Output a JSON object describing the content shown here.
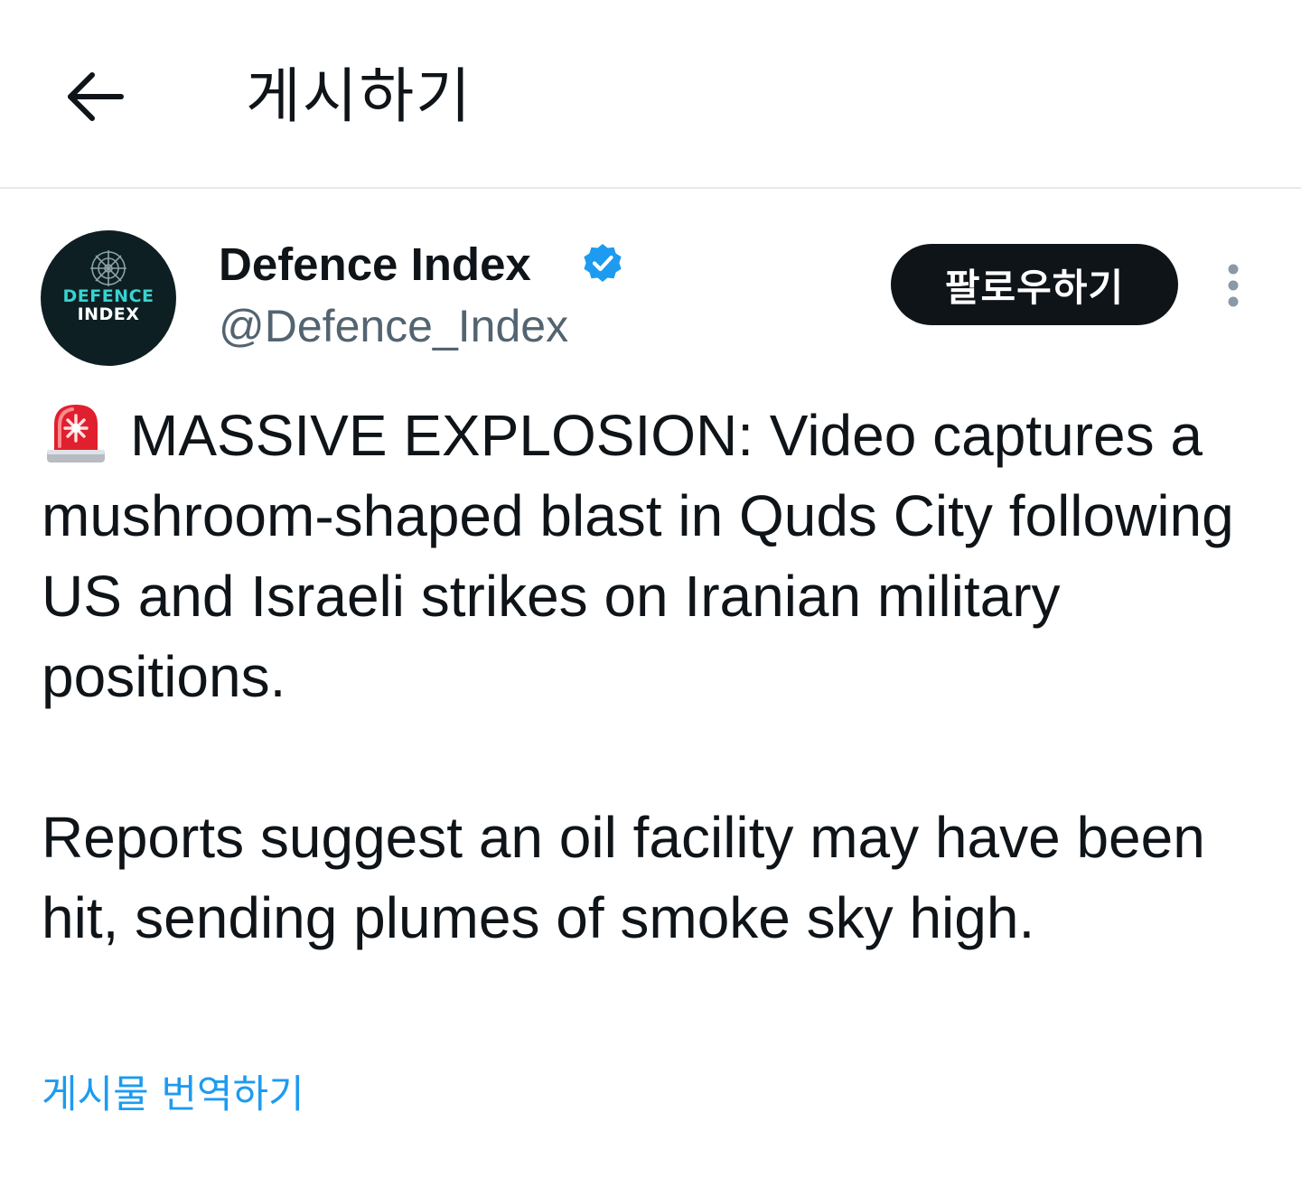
{
  "header": {
    "title": "게시하기",
    "back_icon": "arrow-left-icon"
  },
  "author": {
    "avatar_line1": "DEFENCE",
    "avatar_line2": "INDEX",
    "display_name": "Defence Index",
    "handle": "@Defence_Index",
    "verified": true,
    "verified_color": "#1d9bf0"
  },
  "actions": {
    "follow_label": "팔로우하기",
    "more_icon": "more-vertical-icon"
  },
  "tweet": {
    "emoji": "siren-icon",
    "paragraph1": "MASSIVE EXPLOSION: Video captures a mushroom-shaped blast in Quds City following US and Israeli strikes on Iranian military positions.",
    "paragraph2": "Reports suggest an oil facility may have been hit, sending plumes of smoke sky high.",
    "translate_label": "게시물 번역하기"
  },
  "colors": {
    "text": "#0f1419",
    "secondary": "#536471",
    "link": "#1d9bf0",
    "button_bg": "#0f1419",
    "divider": "#e7e9ea"
  }
}
